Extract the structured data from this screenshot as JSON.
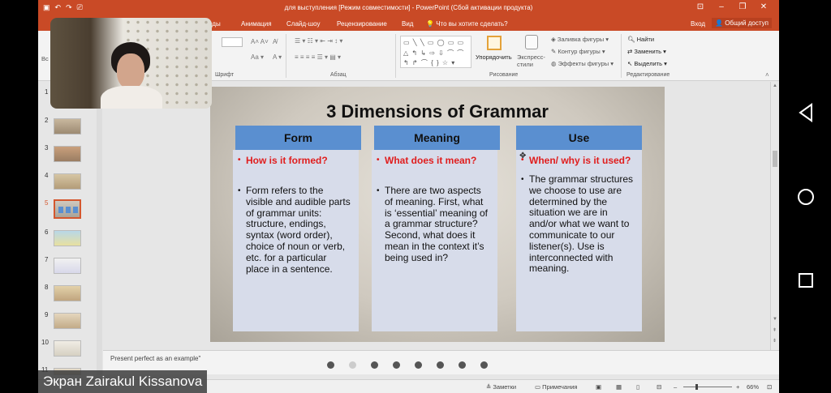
{
  "window": {
    "title": "для выступления [Режим совместимости] - PowerPoint (Сбой активации продукта)"
  },
  "tabs": {
    "visible": [
      {
        "label": "оды"
      },
      {
        "label": "Анимация"
      },
      {
        "label": "Слайд-шоу"
      },
      {
        "label": "Рецензирование"
      },
      {
        "label": "Вид"
      }
    ],
    "tell_me": "Что вы хотите сделать?",
    "sign_in": "Вход",
    "share": "Общий доступ"
  },
  "ribbon": {
    "group_font": "Шрифт",
    "group_paragraph": "Абзац",
    "group_drawing": "Рисование",
    "group_editing": "Редактирование",
    "left_fragment": "Вс",
    "arrange": "Упорядочить",
    "quick_styles": "Экспресс-стили",
    "shape_fill": "Заливка фигуры",
    "shape_outline": "Контур фигуры",
    "shape_effects": "Эффекты фигуры",
    "find": "Найти",
    "replace": "Заменить",
    "select": "Выделить"
  },
  "thumbnails": {
    "numbers": [
      "1",
      "2",
      "3",
      "4",
      "5",
      "6",
      "7",
      "8",
      "9",
      "10",
      "11"
    ],
    "selected": "5"
  },
  "slide": {
    "title": "3 Dimensions of Grammar",
    "columns": [
      {
        "header": "Form",
        "question": "How is it formed?",
        "text": "Form refers to the visible and audible parts of grammar units: structure, endings, syntax (word order), choice of noun or verb, etc. for a particular place in a sentence."
      },
      {
        "header": "Meaning",
        "question": "What does it mean?",
        "text": "There are two aspects of meaning. First, what is ‘essential’ meaning of a grammar structure? Second, what does it mean in the context it’s being used in?"
      },
      {
        "header": "Use",
        "question": "When/ why is it used?",
        "text": "The grammar structures we choose to use are determined by the situation we are in and/or what we want to communicate to our listener(s). Use is interconnected with meaning."
      }
    ]
  },
  "notes": {
    "text": "Present perfect as an  example\""
  },
  "status": {
    "notes": "Заметки",
    "comments": "Примечания",
    "zoom": "66%"
  },
  "overlay": {
    "caption": "Экран Zairakul  Kissanova"
  },
  "pager": {
    "count": 8,
    "active": 2
  },
  "colors": {
    "accent": "#c94a26",
    "column_header": "#5a8fd0",
    "column_body": "#d7dcea",
    "question": "#e01d1d"
  }
}
